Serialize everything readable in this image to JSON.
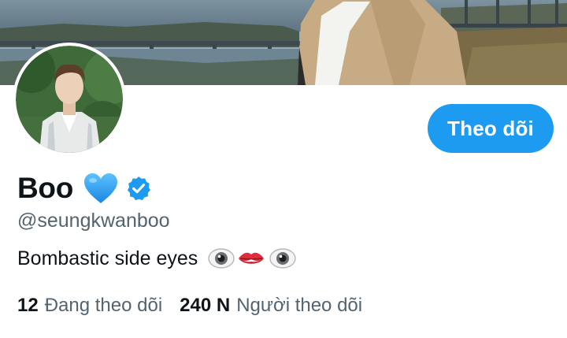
{
  "profile": {
    "display_name": "Boo",
    "handle": "@seungkwanboo",
    "bio": "Bombastic side eyes",
    "bio_emojis": [
      "eye",
      "lips",
      "eye"
    ],
    "verified": true
  },
  "actions": {
    "follow_label": "Theo dõi"
  },
  "stats": {
    "following_count": "12",
    "following_label": "Đang theo dõi",
    "followers_count": "240 N",
    "followers_label": "Người theo dõi"
  },
  "colors": {
    "accent": "#1d9bf0",
    "text_primary": "#0f1419",
    "text_secondary": "#536471",
    "heart": "#2d9cf2"
  },
  "icons": {
    "heart": "blue-heart-icon",
    "verified": "verified-badge-icon"
  }
}
